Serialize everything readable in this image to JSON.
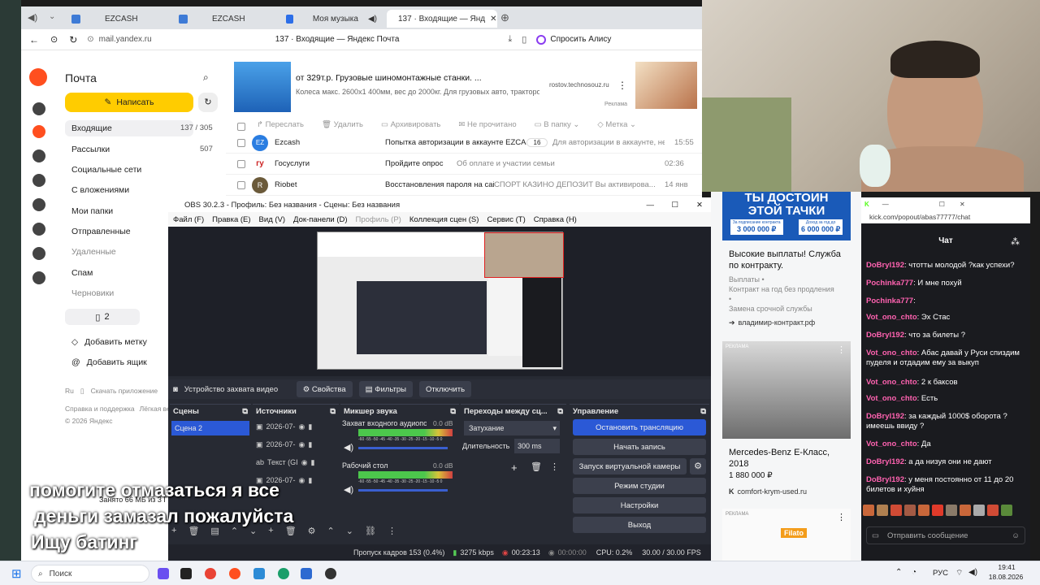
{
  "browser": {
    "tabs": [
      "EZCASH",
      "EZCASH",
      "Моя музыка",
      "137 · Входящие — Янд"
    ],
    "url": "mail.yandex.ru",
    "page_title": "137 · Входящие — Яндекс Почта",
    "alice": "Спросить Алису",
    "ad": {
      "title": "от 329т.р. Грузовые шиномонтажные станки. ...",
      "desc": "Колеса макс. 2600х1 400мм, вес до 2000кг. Для грузовых авто, тракторов...",
      "domain": "rostov.technosouz.ru",
      "label": "Реклама"
    }
  },
  "mail": {
    "brand": "Почта",
    "compose": "Написать",
    "folders": [
      {
        "label": "Входящие",
        "count": "137 / 305"
      },
      {
        "label": "Рассылки",
        "count": "507"
      },
      {
        "label": "Социальные сети",
        "count": ""
      },
      {
        "label": "С вложениями",
        "count": ""
      },
      {
        "label": "Мои папки",
        "count": ""
      },
      {
        "label": "Отправленные",
        "count": ""
      },
      {
        "label": "Удаленные",
        "count": ""
      },
      {
        "label": "Спам",
        "count": ""
      },
      {
        "label": "Черновики",
        "count": ""
      }
    ],
    "tags_count": "2",
    "add_label": "Добавить метку",
    "add_box": "Добавить ящик",
    "lang": "Ru",
    "download": "Скачать приложение",
    "support": "Справка и поддержка",
    "light": "Лёгкая верс",
    "copyright": "© 2026 Яндекс",
    "storage": "Занято 66 МБ из 3 ГБ",
    "toolbar": [
      "Переслать",
      "Удалить",
      "Архивировать",
      "Не прочитано",
      "В папку",
      "Метка"
    ],
    "messages": [
      {
        "avatar": "EZ",
        "sender": "Ezcash",
        "subject": "Попытка авторизации в аккаунте EZCASH",
        "count": "16",
        "snippet": "Для авторизации в аккаунте, не...",
        "time": "15:55"
      },
      {
        "avatar": "гу",
        "sender": "Госуслуги",
        "subject": "Пройдите опрос",
        "count": "",
        "snippet": "Об оплате и участии семьи",
        "time": "02:36"
      },
      {
        "avatar": "R",
        "sender": "Riobet",
        "subject": "Восстановления пароля на сайте Riobet",
        "count": "",
        "snippet": "СПОРТ КАЗИНО ДЕПОЗИТ Вы активирова...",
        "time": "14 янв"
      }
    ]
  },
  "obs": {
    "title": "OBS 30.2.3 - Профиль: Без названия - Сцены: Без названия",
    "menu": [
      "Файл (F)",
      "Правка (E)",
      "Вид (V)",
      "Док-панели (D)",
      "Профиль (P)",
      "Коллекция сцен (S)",
      "Сервис (T)",
      "Справка (H)"
    ],
    "source_name": "Устройство захвата видео",
    "properties": "Свойства",
    "filters": "Фильтры",
    "disconnect": "Отключить",
    "docks": {
      "scenes": "Сцены",
      "sources": "Источники",
      "mixer": "Микшер звука",
      "transitions": "Переходы между сц...",
      "controls": "Управление"
    },
    "scene": "Сцена 2",
    "sources": [
      "2026-07-",
      "2026-07-",
      "Текст (GI",
      "2026-07-"
    ],
    "mixer": [
      {
        "name": "Захват входного аудиопот",
        "db": "0.0 dB"
      },
      {
        "name": "Рабочий стол",
        "db": "0.0 dB"
      }
    ],
    "meter_ticks": "-60 -55 -50 -45 -40 -35 -30 -25 -20 -15 -10 -5 0",
    "transition": "Затухание",
    "duration_label": "Длительность",
    "duration": "300 ms",
    "controls": [
      "Остановить трансляцию",
      "Начать запись",
      "Запуск виртуальной камеры",
      "Режим студии",
      "Настройки",
      "Выход"
    ],
    "status": {
      "dropped": "Пропуск кадров 153 (0.4%)",
      "bitrate": "3275 kbps",
      "stream_time": "00:23:13",
      "rec_time": "00:00:00",
      "cpu": "CPU: 0.2%",
      "fps": "30.00 / 30.00 FPS"
    }
  },
  "ads": {
    "banner_line1": "ТЫ ДОСТОИН",
    "banner_line2": "ЭТОЙ ТАЧКИ",
    "price1": "3 000 000 ₽",
    "price1_label": "За подписание контракта",
    "price2": "6 000 000 ₽",
    "price2_label": "Доход за год до",
    "headline": "Высокие выплаты! Служба по контракту.",
    "sub1": "Выплаты •",
    "sub2": "Контракт на год без продления",
    "sub3": "•",
    "sub4": "Замена срочной службы",
    "domain1": "владимир-контракт.рф",
    "label": "РЕКЛАМА",
    "car_title": "Mercedes-Benz E-Класс, 2018",
    "car_price": "1 880 000 ₽",
    "domain2": "comfort-krym-used.ru",
    "brand3": "Filato"
  },
  "chat": {
    "url": "kick.com/popout/abas77777/chat",
    "header": "Чат",
    "messages": [
      {
        "user": "DoBryl192",
        "text": "чтотты молодой ?как успехи?",
        "color": "#ff62b0"
      },
      {
        "user": "Pochinka777",
        "text": "И мне похуй",
        "color": "#ff62b0"
      },
      {
        "user": "Pochinka777",
        "text": "",
        "color": "#ff62b0"
      },
      {
        "user": "Vot_ono_chto",
        "text": "Эх Стас",
        "color": "#ff62b0"
      },
      {
        "user": "DoBryl192",
        "text": "что за билеты ?",
        "color": "#ff62b0"
      },
      {
        "user": "Vot_ono_chto",
        "text": "Абас давай у Руси спиздим пуделя и отдадим ему за выкуп",
        "color": "#ff62b0"
      },
      {
        "user": "Vot_ono_chto",
        "text": "2 к баксов",
        "color": "#ff62b0"
      },
      {
        "user": "Vot_ono_chto",
        "text": "Есть",
        "color": "#ff62b0"
      },
      {
        "user": "DoBryl192",
        "text": "за каждый 1000$ оборота ? имеешь ввиду ?",
        "color": "#ff62b0"
      },
      {
        "user": "Vot_ono_chto",
        "text": "Да",
        "color": "#ff62b0"
      },
      {
        "user": "DoBryl192",
        "text": "а да низуя они не дают",
        "color": "#ff62b0"
      },
      {
        "user": "DoBryl192",
        "text": "у меня постоянно от 11 до 20 билетов и хуйня",
        "color": "#ff62b0"
      }
    ],
    "send_placeholder": "Отправить сообщение"
  },
  "caption": {
    "line1": "помогите отмазаться я все",
    "line2": "деньги замазал пожалуйста",
    "line3": "Ищу батинг"
  },
  "taskbar": {
    "search": "Поиск",
    "lang": "РУС",
    "time": "19:41",
    "date": "18.08.2026"
  },
  "colors": {
    "yandex_yellow": "#ffcc00",
    "obs_bg": "#272a33",
    "obs_accent": "#2b59d6",
    "kick_green": "#53fc18"
  }
}
